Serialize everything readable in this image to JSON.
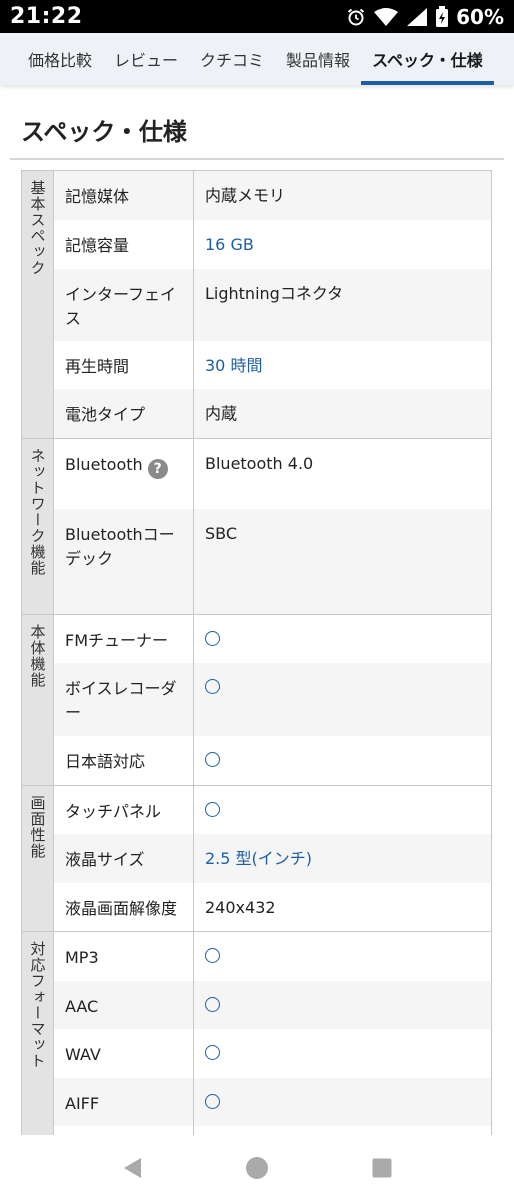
{
  "status_bar": {
    "time": "21:22",
    "battery": "60%",
    "icons": [
      "alarm-icon",
      "wifi-icon",
      "signal-icon",
      "battery-icon"
    ]
  },
  "tabs": [
    {
      "label": "価格比較",
      "active": false
    },
    {
      "label": "レビュー",
      "active": false
    },
    {
      "label": "クチコミ",
      "active": false
    },
    {
      "label": "製品情報",
      "active": false
    },
    {
      "label": "スペック・仕様",
      "active": true
    }
  ],
  "section_title": "スペック・仕様",
  "spec_groups": [
    {
      "name": "基本スペック",
      "rows": [
        {
          "label": "記憶媒体",
          "value": "内蔵メモリ",
          "link": false
        },
        {
          "label": "記憶容量",
          "value": "16 GB",
          "link": true
        },
        {
          "label": "インターフェイス",
          "value": "Lightningコネクタ",
          "link": false
        },
        {
          "label": "再生時間",
          "value": "30 時間",
          "link": true
        },
        {
          "label": "電池タイプ",
          "value": "内蔵",
          "link": false
        }
      ]
    },
    {
      "name": "ネットワーク機能",
      "rows": [
        {
          "label": "Bluetooth",
          "value": "Bluetooth 4.0",
          "link": false,
          "help": "?"
        },
        {
          "label": "Bluetoothコーデック",
          "value": "SBC",
          "link": false
        }
      ]
    },
    {
      "name": "本体機能",
      "rows": [
        {
          "label": "FMチューナー",
          "value": "○",
          "link": false,
          "circle": true
        },
        {
          "label": "ボイスレコーダー",
          "value": "○",
          "link": false,
          "circle": true
        },
        {
          "label": "日本語対応",
          "value": "○",
          "link": false,
          "circle": true
        }
      ]
    },
    {
      "name": "画面性能",
      "rows": [
        {
          "label": "タッチパネル",
          "value": "○",
          "link": false,
          "circle": true
        },
        {
          "label": "液晶サイズ",
          "value": "2.5 型(インチ)",
          "link": true
        },
        {
          "label": "液晶画面解像度",
          "value": "240x432",
          "link": false
        }
      ]
    },
    {
      "name": "対応フォーマット",
      "rows": [
        {
          "label": "MP3",
          "value": "○",
          "link": false,
          "circle": true
        },
        {
          "label": "AAC",
          "value": "○",
          "link": false,
          "circle": true
        },
        {
          "label": "WAV",
          "value": "○",
          "link": false,
          "circle": true
        },
        {
          "label": "AIFF",
          "value": "○",
          "link": false,
          "circle": true
        }
      ]
    }
  ],
  "colors": {
    "accent": "#1d5fa6",
    "group_bg": "#e3e3e3",
    "row_alt": "#f5f5f5",
    "tab_bg": "#eef2f7"
  },
  "nav": [
    "back-icon",
    "home-icon",
    "recents-icon"
  ]
}
